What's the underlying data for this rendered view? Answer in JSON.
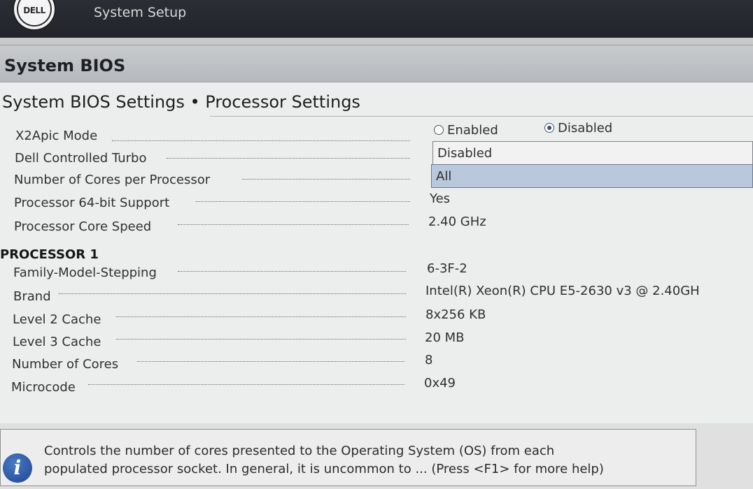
{
  "header": {
    "logo_text": "DELL",
    "app_title": "System Setup"
  },
  "bios_title": "System BIOS",
  "page_title": "System BIOS Settings • Processor Settings",
  "settings": {
    "x2apic": {
      "label": "X2Apic Mode",
      "options": [
        "Enabled",
        "Disabled"
      ],
      "selected": "Disabled"
    },
    "dell_turbo": {
      "label": "Dell Controlled Turbo",
      "value": "Disabled"
    },
    "cores_per_processor": {
      "label": "Number of Cores per Processor",
      "value": "All"
    },
    "proc_64bit": {
      "label": "Processor 64-bit Support",
      "value": "Yes"
    },
    "core_speed": {
      "label": "Processor Core Speed",
      "value": "2.40 GHz"
    }
  },
  "processor1": {
    "heading": "PROCESSOR 1",
    "rows": [
      {
        "label": "Family-Model-Stepping",
        "value": "6-3F-2"
      },
      {
        "label": "Brand",
        "value": "Intel(R) Xeon(R) CPU E5-2630 v3 @ 2.40GH"
      },
      {
        "label": "Level 2 Cache",
        "value": "8x256 KB"
      },
      {
        "label": "Level 3 Cache",
        "value": "20 MB"
      },
      {
        "label": "Number of Cores",
        "value": "8"
      },
      {
        "label": "Microcode",
        "value": "0x49"
      }
    ]
  },
  "help": {
    "icon": "info-icon",
    "line1": "Controls the number of cores presented to the Operating System (OS) from each",
    "line2": "populated processor socket. In general, it is uncommon to ... (Press <F1> for more help)"
  }
}
